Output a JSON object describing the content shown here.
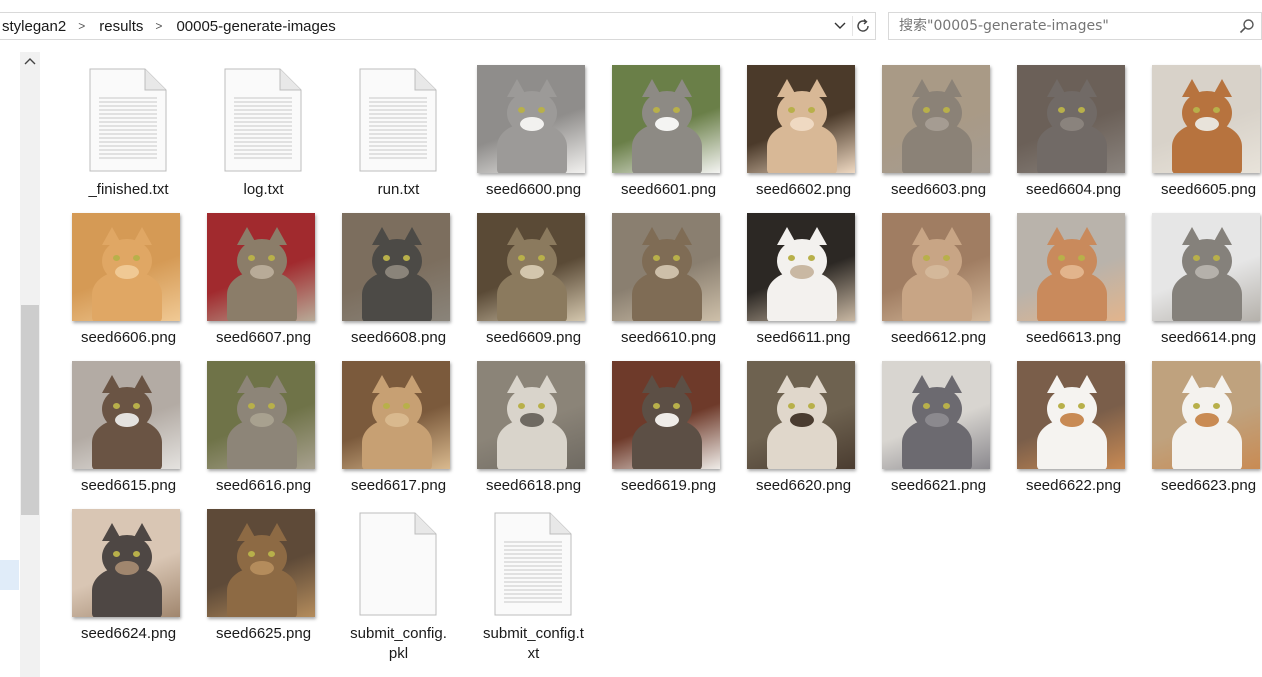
{
  "breadcrumb": {
    "items": [
      "stylegan2",
      "results",
      "00005-generate-images"
    ],
    "separator": ">"
  },
  "search": {
    "placeholder": "搜索\"00005-generate-images\""
  },
  "files": [
    {
      "name": "_finished.txt",
      "kind": "text"
    },
    {
      "name": "log.txt",
      "kind": "text"
    },
    {
      "name": "run.txt",
      "kind": "text"
    },
    {
      "name": "seed6600.png",
      "kind": "image",
      "bg": "#8f8d8b",
      "fur": "#9c9a98",
      "accent": "#f2f1ef"
    },
    {
      "name": "seed6601.png",
      "kind": "image",
      "bg": "#6a7f48",
      "fur": "#8d8a84",
      "accent": "#f4f4f2"
    },
    {
      "name": "seed6602.png",
      "kind": "image",
      "bg": "#4b3a2a",
      "fur": "#d8b896",
      "accent": "#efd9c2"
    },
    {
      "name": "seed6603.png",
      "kind": "image",
      "bg": "#a99a86",
      "fur": "#8b8277",
      "accent": "#a59c92"
    },
    {
      "name": "seed6604.png",
      "kind": "image",
      "bg": "#6b6058",
      "fur": "#716a66",
      "accent": "#8a837d"
    },
    {
      "name": "seed6605.png",
      "kind": "image",
      "bg": "#d8d2c9",
      "fur": "#b7733e",
      "accent": "#e8e3da"
    },
    {
      "name": "seed6606.png",
      "kind": "image",
      "bg": "#d59a55",
      "fur": "#e0a764",
      "accent": "#f0c994"
    },
    {
      "name": "seed6607.png",
      "kind": "image",
      "bg": "#a12a2e",
      "fur": "#8b7d69",
      "accent": "#b8ab98"
    },
    {
      "name": "seed6608.png",
      "kind": "image",
      "bg": "#7c6e5e",
      "fur": "#4c4a46",
      "accent": "#8a847a"
    },
    {
      "name": "seed6609.png",
      "kind": "image",
      "bg": "#5a4a36",
      "fur": "#8b7a5e",
      "accent": "#d3c6ad"
    },
    {
      "name": "seed6610.png",
      "kind": "image",
      "bg": "#8a7f70",
      "fur": "#7f6c55",
      "accent": "#cdbfa9"
    },
    {
      "name": "seed6611.png",
      "kind": "image",
      "bg": "#2c2824",
      "fur": "#f3f1ee",
      "accent": "#c9b8a3"
    },
    {
      "name": "seed6612.png",
      "kind": "image",
      "bg": "#a07d62",
      "fur": "#c8a585",
      "accent": "#d4b89a"
    },
    {
      "name": "seed6613.png",
      "kind": "image",
      "bg": "#b9b3ab",
      "fur": "#c98a5c",
      "accent": "#e2b48c"
    },
    {
      "name": "seed6614.png",
      "kind": "image",
      "bg": "#e6e6e6",
      "fur": "#85817b",
      "accent": "#b5b1ab"
    },
    {
      "name": "seed6615.png",
      "kind": "image",
      "bg": "#b3aba4",
      "fur": "#6a5444",
      "accent": "#e4e2df"
    },
    {
      "name": "seed6616.png",
      "kind": "image",
      "bg": "#6f7348",
      "fur": "#8d8578",
      "accent": "#a8a18f"
    },
    {
      "name": "seed6617.png",
      "kind": "image",
      "bg": "#7b5a3c",
      "fur": "#c7a073",
      "accent": "#d9b98e"
    },
    {
      "name": "seed6618.png",
      "kind": "image",
      "bg": "#8b8478",
      "fur": "#d9d4cb",
      "accent": "#6f6a62"
    },
    {
      "name": "seed6619.png",
      "kind": "image",
      "bg": "#6e3a2a",
      "fur": "#5c4f45",
      "accent": "#efece8"
    },
    {
      "name": "seed6620.png",
      "kind": "image",
      "bg": "#6e6250",
      "fur": "#e0d7cb",
      "accent": "#4a3c30"
    },
    {
      "name": "seed6621.png",
      "kind": "image",
      "bg": "#d8d5d0",
      "fur": "#6c6a70",
      "accent": "#8b898e"
    },
    {
      "name": "seed6622.png",
      "kind": "image",
      "bg": "#7a5e4a",
      "fur": "#f5f3f0",
      "accent": "#c88a54"
    },
    {
      "name": "seed6623.png",
      "kind": "image",
      "bg": "#bfa27e",
      "fur": "#f4f2ee",
      "accent": "#c98b53"
    },
    {
      "name": "seed6624.png",
      "kind": "image",
      "bg": "#d9c6b4",
      "fur": "#4e4744",
      "accent": "#a0866e"
    },
    {
      "name": "seed6625.png",
      "kind": "image",
      "bg": "#5e4a38",
      "fur": "#8d6a44",
      "accent": "#b48c5c"
    },
    {
      "name": "submit_config.pkl",
      "kind": "blank",
      "display": "submit_config.\npkl"
    },
    {
      "name": "submit_config.txt",
      "kind": "text",
      "display": "submit_config.t\nxt"
    }
  ],
  "colors": {
    "selection": "#cce0f5",
    "border": "#d9d9d9",
    "scroll_thumb": "#cdcdcd"
  },
  "icons": {
    "dropdown": "chevron-down-icon",
    "refresh": "refresh-icon",
    "search": "search-icon",
    "scroll_up": "chevron-up-icon"
  }
}
